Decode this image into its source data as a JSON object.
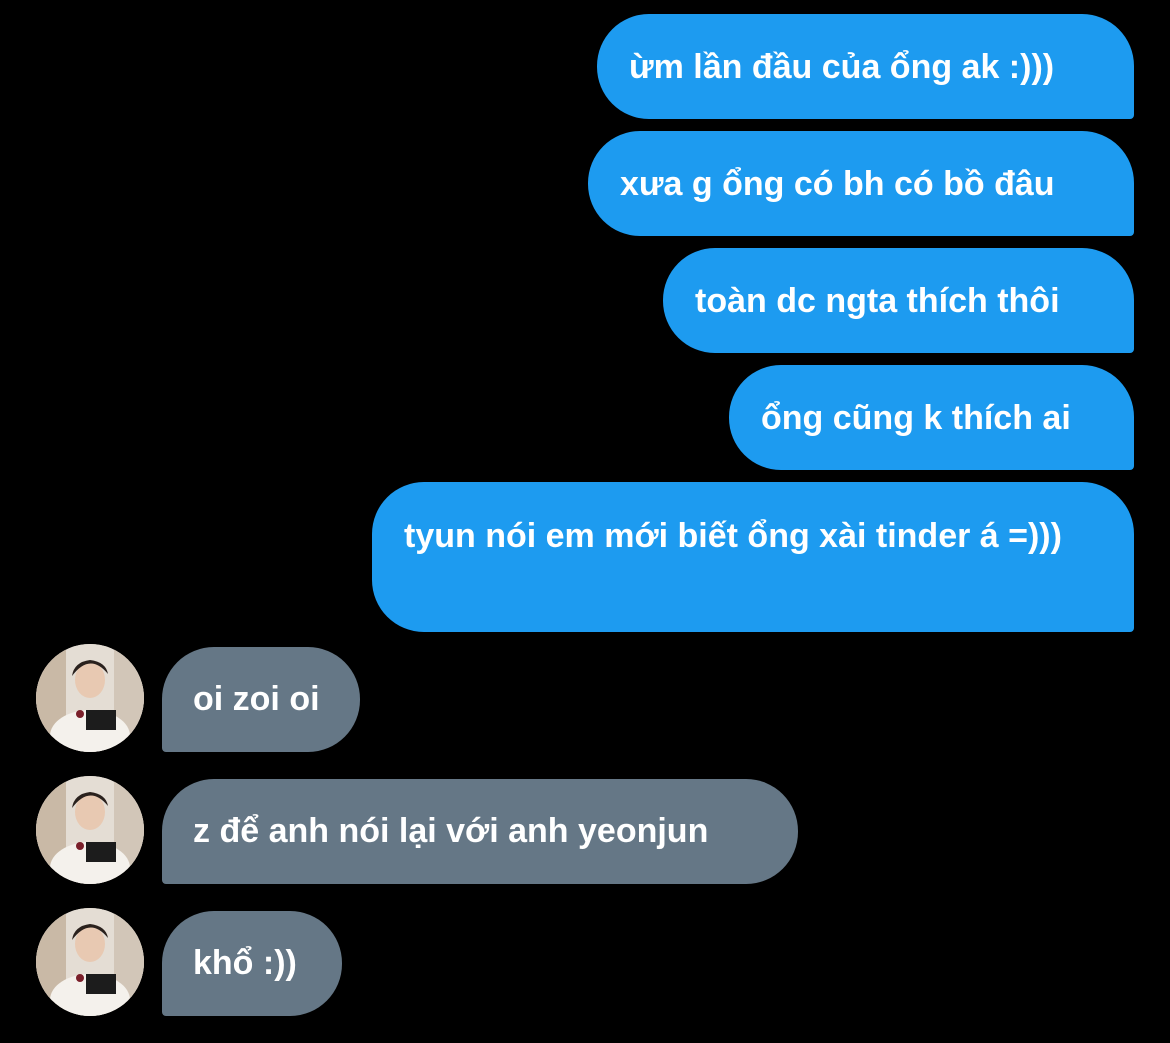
{
  "colors": {
    "background": "#000000",
    "outgoing_bubble": "#1d9bf0",
    "incoming_bubble": "#657786",
    "text": "#ffffff"
  },
  "messages": [
    {
      "direction": "outgoing",
      "text": "ừm lần đầu của ổng ak :)))"
    },
    {
      "direction": "outgoing",
      "text": "xưa g ổng có bh có bồ đâu"
    },
    {
      "direction": "outgoing",
      "text": "toàn dc ngta thích thôi"
    },
    {
      "direction": "outgoing",
      "text": "ổng cũng k thích ai"
    },
    {
      "direction": "outgoing",
      "text": "tyun nói em mới biết ổng xài tinder á =)))"
    },
    {
      "direction": "incoming",
      "text": "oi zoi oi",
      "avatar_icon": "profile-photo-icon"
    },
    {
      "direction": "incoming",
      "text": "z để anh nói lại với anh yeonjun",
      "avatar_icon": "profile-photo-icon"
    },
    {
      "direction": "incoming",
      "text": "khổ :))",
      "avatar_icon": "profile-photo-icon"
    }
  ]
}
